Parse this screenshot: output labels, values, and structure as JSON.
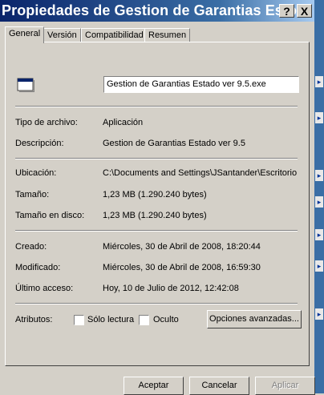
{
  "window": {
    "title": "Propiedades de Gestion de Garantias Esto...",
    "help_label": "?",
    "close_label": "X"
  },
  "tabs": [
    {
      "label": "General"
    },
    {
      "label": "Versión"
    },
    {
      "label": "Compatibilidad"
    },
    {
      "label": "Resumen"
    }
  ],
  "general": {
    "file_name": "Gestion de Garantias Estado ver 9.5.exe",
    "file_type_label": "Tipo de archivo:",
    "file_type_value": "Aplicación",
    "description_label": "Descripción:",
    "description_value": "Gestion de Garantias Estado ver 9.5",
    "location_label": "Ubicación:",
    "location_value": "C:\\Documents and Settings\\JSantander\\Escritorio",
    "size_label": "Tamaño:",
    "size_value": "1,23 MB (1.290.240 bytes)",
    "size_on_disk_label": "Tamaño en disco:",
    "size_on_disk_value": "1,23 MB (1.290.240 bytes)",
    "created_label": "Creado:",
    "created_value": "Miércoles, 30 de Abril de 2008, 18:20:44",
    "modified_label": "Modificado:",
    "modified_value": "Miércoles, 30 de Abril de 2008, 16:59:30",
    "accessed_label": "Último acceso:",
    "accessed_value": "Hoy, 10 de Julio de 2012, 12:42:08",
    "attributes_label": "Atributos:",
    "readonly_label": "Sólo lectura",
    "hidden_label": "Oculto",
    "advanced_button": "Opciones avanzadas..."
  },
  "buttons": {
    "ok": "Aceptar",
    "cancel": "Cancelar",
    "apply": "Aplicar"
  },
  "colors": {
    "titlebar_start": "#0a246a",
    "titlebar_end": "#a6caf0",
    "dialog_face": "#d4d0c8"
  }
}
